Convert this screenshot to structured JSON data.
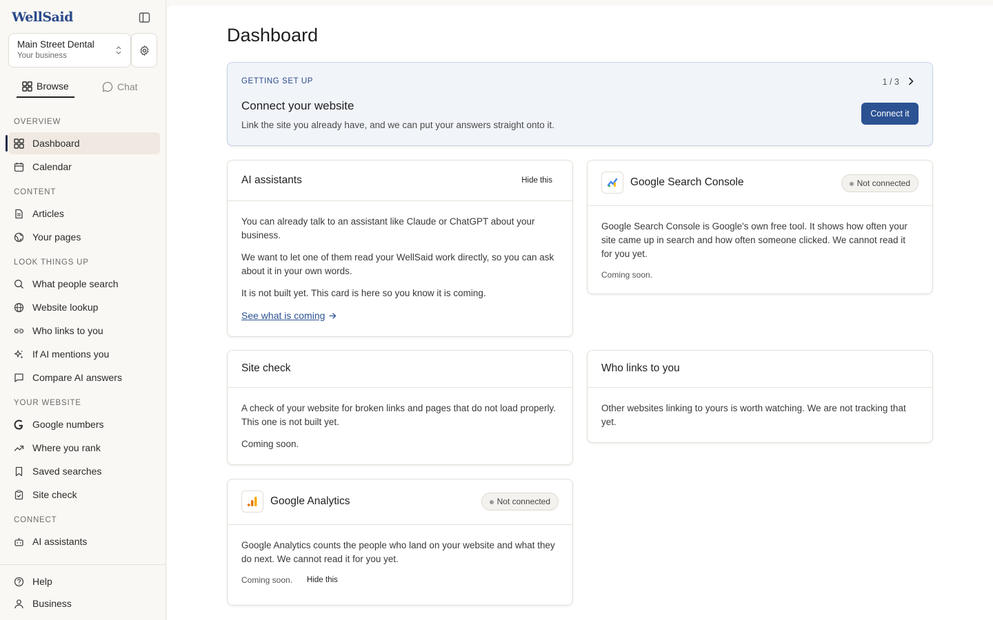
{
  "app": {
    "logo": "WellSaid"
  },
  "business": {
    "name": "Main Street Dental",
    "subtitle": "Your business"
  },
  "mode_tabs": {
    "browse": "Browse",
    "chat": "Chat"
  },
  "nav": {
    "overview": "OVERVIEW",
    "dashboard": "Dashboard",
    "calendar": "Calendar",
    "content": "CONTENT",
    "articles": "Articles",
    "your_pages": "Your pages",
    "look_up": "LOOK THINGS UP",
    "what_people_search": "What people search",
    "website_lookup": "Website lookup",
    "who_links": "Who links to you",
    "ai_mentions": "If AI mentions you",
    "compare_ai": "Compare AI answers",
    "your_website": "YOUR WEBSITE",
    "google_numbers": "Google numbers",
    "where_rank": "Where you rank",
    "saved_searches": "Saved searches",
    "site_check": "Site check",
    "connect": "CONNECT",
    "ai_assistants": "AI assistants",
    "help": "Help",
    "business": "Business"
  },
  "page": {
    "title": "Dashboard"
  },
  "setup": {
    "label": "GETTING SET UP",
    "pager": "1 / 3",
    "title": "Connect your website",
    "desc": "Link the site you already have, and we can put your answers straight onto it.",
    "button": "Connect it"
  },
  "ai_card": {
    "title": "AI assistants",
    "hide": "Hide this",
    "p1": "You can already talk to an assistant like Claude or ChatGPT about your business.",
    "p2": "We want to let one of them read your WellSaid work directly, so you can ask about it in your own words.",
    "p3": "It is not built yet. This card is here so you know it is coming.",
    "link": "See what is coming"
  },
  "gsc_card": {
    "title": "Google Search Console",
    "badge": "Not connected",
    "body": "Google Search Console is Google's own free tool. It shows how often your site came up in search and how often someone clicked. We cannot read it for you yet.",
    "soon": "Coming soon."
  },
  "site_card": {
    "title": "Site check",
    "body": "A check of your website for broken links and pages that do not load properly. This one is not built yet.",
    "soon": "Coming soon."
  },
  "links_card": {
    "title": "Who links to you",
    "body": "Other websites linking to yours is worth watching. We are not tracking that yet."
  },
  "ga_card": {
    "title": "Google Analytics",
    "badge": "Not connected",
    "body": "Google Analytics counts the people who land on your website and what they do next. We cannot read it for you yet.",
    "soon": "Coming soon.",
    "hide": "Hide this"
  },
  "colors": {
    "accent": "#2c5293",
    "setup_bg": "#f1f4f9",
    "sidebar_bg": "#faf8f4"
  }
}
